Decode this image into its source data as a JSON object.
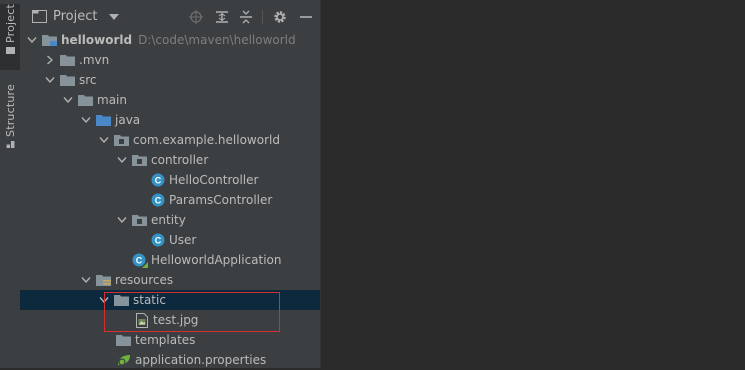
{
  "side_tabs": {
    "project": "Project",
    "structure": "Structure"
  },
  "panel": {
    "title": "Project"
  },
  "tree": {
    "project_name": "helloworld",
    "project_path": "D:\\code\\maven\\helloworld",
    "mvn": ".mvn",
    "src": "src",
    "main": "main",
    "java": "java",
    "package": "com.example.helloworld",
    "controller": "controller",
    "hello_controller": "HelloController",
    "params_controller": "ParamsController",
    "entity": "entity",
    "user": "User",
    "app": "HelloworldApplication",
    "resources": "resources",
    "static": "static",
    "test_jpg": "test.jpg",
    "templates": "templates",
    "app_props": "application.properties"
  },
  "colors": {
    "panel_bg": "#3c3f41",
    "editor_bg": "#2b2b2b",
    "selection": "#0d293e",
    "folder_blue": "#87939a",
    "source_folder": "#4a88c7",
    "class_icon": "#3592c4",
    "highlight": "#d32f2f"
  }
}
